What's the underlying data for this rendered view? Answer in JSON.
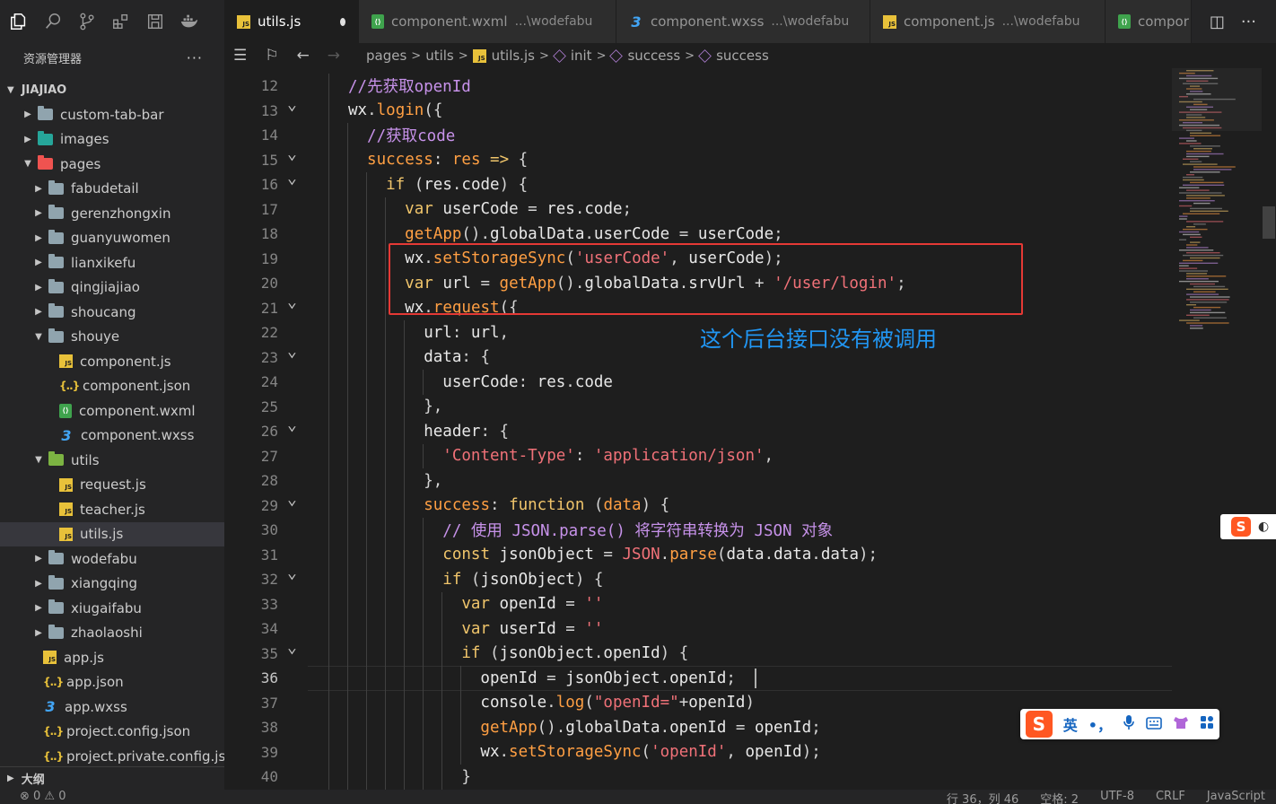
{
  "tabs": [
    {
      "name": "utils.js",
      "desc": "",
      "icon": "js",
      "active": true,
      "modified": true
    },
    {
      "name": "component.wxml",
      "desc": "...\\wodefabu",
      "icon": "wxml"
    },
    {
      "name": "component.wxss",
      "desc": "...\\wodefabu",
      "icon": "css"
    },
    {
      "name": "component.js",
      "desc": "...\\wodefabu",
      "icon": "js"
    },
    {
      "name": "compor",
      "desc": "",
      "icon": "wxml"
    }
  ],
  "sidebar": {
    "title": "资源管理器",
    "more": "···",
    "root": "JIAJIAO",
    "items": [
      {
        "label": "custom-tab-bar",
        "depth": 0,
        "type": "folder",
        "open": false
      },
      {
        "label": "images",
        "depth": 0,
        "type": "folder-images",
        "open": false
      },
      {
        "label": "pages",
        "depth": 0,
        "type": "folder-pages",
        "open": true
      },
      {
        "label": "fabudetail",
        "depth": 1,
        "type": "folder",
        "open": false
      },
      {
        "label": "gerenzhongxin",
        "depth": 1,
        "type": "folder",
        "open": false
      },
      {
        "label": "guanyuwomen",
        "depth": 1,
        "type": "folder",
        "open": false
      },
      {
        "label": "lianxikefu",
        "depth": 1,
        "type": "folder",
        "open": false
      },
      {
        "label": "qingjiajiao",
        "depth": 1,
        "type": "folder",
        "open": false
      },
      {
        "label": "shoucang",
        "depth": 1,
        "type": "folder",
        "open": false
      },
      {
        "label": "shouye",
        "depth": 1,
        "type": "folder",
        "open": true
      },
      {
        "label": "component.js",
        "depth": 2,
        "type": "js"
      },
      {
        "label": "component.json",
        "depth": 2,
        "type": "json"
      },
      {
        "label": "component.wxml",
        "depth": 2,
        "type": "wxml"
      },
      {
        "label": "component.wxss",
        "depth": 2,
        "type": "css"
      },
      {
        "label": "utils",
        "depth": 1,
        "type": "folder-utils",
        "open": true
      },
      {
        "label": "request.js",
        "depth": 2,
        "type": "js"
      },
      {
        "label": "teacher.js",
        "depth": 2,
        "type": "js"
      },
      {
        "label": "utils.js",
        "depth": 2,
        "type": "js",
        "selected": true
      },
      {
        "label": "wodefabu",
        "depth": 1,
        "type": "folder",
        "open": false
      },
      {
        "label": "xiangqing",
        "depth": 1,
        "type": "folder",
        "open": false
      },
      {
        "label": "xiugaifabu",
        "depth": 1,
        "type": "folder",
        "open": false
      },
      {
        "label": "zhaolaoshi",
        "depth": 1,
        "type": "folder",
        "open": false
      },
      {
        "label": "app.js",
        "depth": 0.5,
        "type": "js"
      },
      {
        "label": "app.json",
        "depth": 0.5,
        "type": "json"
      },
      {
        "label": "app.wxss",
        "depth": 0.5,
        "type": "css"
      },
      {
        "label": "project.config.json",
        "depth": 0.5,
        "type": "json"
      },
      {
        "label": "project.private.config.js...",
        "depth": 0.5,
        "type": "json"
      }
    ],
    "outline": "大纲"
  },
  "breadcrumb": {
    "items": [
      "pages",
      "utils",
      "utils.js",
      "init",
      "success",
      "success"
    ]
  },
  "editor": {
    "current_line": 36,
    "lines": [
      {
        "n": "12",
        "fold": false,
        "indent": 2,
        "tokens": [
          [
            "t-cm",
            "//先获取openId"
          ]
        ]
      },
      {
        "n": "13",
        "fold": true,
        "indent": 2,
        "tokens": [
          [
            "t-id",
            "wx"
          ],
          [
            "t-prop",
            "."
          ],
          [
            "t-fn",
            "login"
          ],
          [
            "t-prop",
            "({"
          ]
        ]
      },
      {
        "n": "14",
        "fold": false,
        "indent": 3,
        "tokens": [
          [
            "t-cm",
            "//获取code"
          ]
        ]
      },
      {
        "n": "15",
        "fold": true,
        "indent": 3,
        "tokens": [
          [
            "t-fn",
            "success"
          ],
          [
            "t-prop",
            ": "
          ],
          [
            "t-fn",
            "res"
          ],
          [
            "t-prop",
            " "
          ],
          [
            "t-key",
            "=>"
          ],
          [
            "t-prop",
            " {"
          ]
        ]
      },
      {
        "n": "16",
        "fold": true,
        "indent": 4,
        "tokens": [
          [
            "t-key",
            "if"
          ],
          [
            "t-prop",
            " ("
          ],
          [
            "t-id",
            "res"
          ],
          [
            "t-prop",
            "."
          ],
          [
            "t-id",
            "code"
          ],
          [
            "t-prop",
            ") {"
          ]
        ]
      },
      {
        "n": "17",
        "fold": false,
        "indent": 5,
        "tokens": [
          [
            "t-key",
            "var"
          ],
          [
            "t-prop",
            " "
          ],
          [
            "t-id",
            "userCode"
          ],
          [
            "t-prop",
            " = "
          ],
          [
            "t-id",
            "res"
          ],
          [
            "t-prop",
            "."
          ],
          [
            "t-id",
            "code"
          ],
          [
            "t-prop",
            ";"
          ]
        ]
      },
      {
        "n": "18",
        "fold": false,
        "indent": 5,
        "tokens": [
          [
            "t-fn",
            "getApp"
          ],
          [
            "t-prop",
            "()."
          ],
          [
            "t-id",
            "globalData"
          ],
          [
            "t-prop",
            "."
          ],
          [
            "t-id",
            "userCode"
          ],
          [
            "t-prop",
            " = "
          ],
          [
            "t-id",
            "userCode"
          ],
          [
            "t-prop",
            ";"
          ]
        ]
      },
      {
        "n": "19",
        "fold": false,
        "indent": 5,
        "tokens": [
          [
            "t-id",
            "wx"
          ],
          [
            "t-prop",
            "."
          ],
          [
            "t-fn",
            "setStorageSync"
          ],
          [
            "t-prop",
            "("
          ],
          [
            "t-str",
            "'userCode'"
          ],
          [
            "t-prop",
            ", "
          ],
          [
            "t-id",
            "userCode"
          ],
          [
            "t-prop",
            ");"
          ]
        ]
      },
      {
        "n": "20",
        "fold": false,
        "indent": 5,
        "tokens": [
          [
            "t-key",
            "var"
          ],
          [
            "t-prop",
            " "
          ],
          [
            "t-id",
            "url"
          ],
          [
            "t-prop",
            " = "
          ],
          [
            "t-fn",
            "getApp"
          ],
          [
            "t-prop",
            "()."
          ],
          [
            "t-id",
            "globalData"
          ],
          [
            "t-prop",
            "."
          ],
          [
            "t-id",
            "srvUrl"
          ],
          [
            "t-prop",
            " + "
          ],
          [
            "t-str",
            "'/user/login'"
          ],
          [
            "t-prop",
            ";"
          ]
        ]
      },
      {
        "n": "21",
        "fold": true,
        "indent": 5,
        "tokens": [
          [
            "t-id",
            "wx"
          ],
          [
            "t-prop",
            "."
          ],
          [
            "t-fn",
            "request"
          ],
          [
            "t-prop",
            "({"
          ]
        ]
      },
      {
        "n": "22",
        "fold": false,
        "indent": 6,
        "tokens": [
          [
            "t-id",
            "url"
          ],
          [
            "t-prop",
            ": "
          ],
          [
            "t-id",
            "url"
          ],
          [
            "t-prop",
            ","
          ]
        ]
      },
      {
        "n": "23",
        "fold": true,
        "indent": 6,
        "tokens": [
          [
            "t-id",
            "data"
          ],
          [
            "t-prop",
            ": {"
          ]
        ]
      },
      {
        "n": "24",
        "fold": false,
        "indent": 7,
        "tokens": [
          [
            "t-id",
            "userCode"
          ],
          [
            "t-prop",
            ": "
          ],
          [
            "t-id",
            "res"
          ],
          [
            "t-prop",
            "."
          ],
          [
            "t-id",
            "code"
          ]
        ]
      },
      {
        "n": "25",
        "fold": false,
        "indent": 6,
        "tokens": [
          [
            "t-prop",
            "},"
          ]
        ]
      },
      {
        "n": "26",
        "fold": true,
        "indent": 6,
        "tokens": [
          [
            "t-id",
            "header"
          ],
          [
            "t-prop",
            ": {"
          ]
        ]
      },
      {
        "n": "27",
        "fold": false,
        "indent": 7,
        "tokens": [
          [
            "t-str",
            "'Content-Type'"
          ],
          [
            "t-prop",
            ": "
          ],
          [
            "t-str",
            "'application/json'"
          ],
          [
            "t-prop",
            ","
          ]
        ]
      },
      {
        "n": "28",
        "fold": false,
        "indent": 6,
        "tokens": [
          [
            "t-prop",
            "},"
          ]
        ]
      },
      {
        "n": "29",
        "fold": true,
        "indent": 6,
        "tokens": [
          [
            "t-fn",
            "success"
          ],
          [
            "t-prop",
            ": "
          ],
          [
            "t-key",
            "function"
          ],
          [
            "t-prop",
            " ("
          ],
          [
            "t-fn",
            "data"
          ],
          [
            "t-prop",
            ") {"
          ]
        ]
      },
      {
        "n": "30",
        "fold": false,
        "indent": 7,
        "tokens": [
          [
            "t-cm",
            "// 使用 JSON.parse() 将字符串转换为 JSON 对象"
          ]
        ]
      },
      {
        "n": "31",
        "fold": false,
        "indent": 7,
        "tokens": [
          [
            "t-key",
            "const"
          ],
          [
            "t-prop",
            " "
          ],
          [
            "t-id",
            "jsonObject"
          ],
          [
            "t-prop",
            " = "
          ],
          [
            "t-str",
            "JSON"
          ],
          [
            "t-prop",
            "."
          ],
          [
            "t-fn",
            "parse"
          ],
          [
            "t-prop",
            "("
          ],
          [
            "t-id",
            "data"
          ],
          [
            "t-prop",
            "."
          ],
          [
            "t-id",
            "data"
          ],
          [
            "t-prop",
            "."
          ],
          [
            "t-id",
            "data"
          ],
          [
            "t-prop",
            ");"
          ]
        ]
      },
      {
        "n": "32",
        "fold": true,
        "indent": 7,
        "tokens": [
          [
            "t-key",
            "if"
          ],
          [
            "t-prop",
            " ("
          ],
          [
            "t-id",
            "jsonObject"
          ],
          [
            "t-prop",
            ") {"
          ]
        ]
      },
      {
        "n": "33",
        "fold": false,
        "indent": 8,
        "tokens": [
          [
            "t-key",
            "var"
          ],
          [
            "t-prop",
            " "
          ],
          [
            "t-id",
            "openId"
          ],
          [
            "t-prop",
            " = "
          ],
          [
            "t-str",
            "''"
          ]
        ]
      },
      {
        "n": "34",
        "fold": false,
        "indent": 8,
        "tokens": [
          [
            "t-key",
            "var"
          ],
          [
            "t-prop",
            " "
          ],
          [
            "t-id",
            "userId"
          ],
          [
            "t-prop",
            " = "
          ],
          [
            "t-str",
            "''"
          ]
        ]
      },
      {
        "n": "35",
        "fold": true,
        "indent": 8,
        "tokens": [
          [
            "t-key",
            "if"
          ],
          [
            "t-prop",
            " ("
          ],
          [
            "t-id",
            "jsonObject"
          ],
          [
            "t-prop",
            "."
          ],
          [
            "t-id",
            "openId"
          ],
          [
            "t-prop",
            ") {"
          ]
        ]
      },
      {
        "n": "36",
        "fold": false,
        "indent": 9,
        "tokens": [
          [
            "t-id",
            "openId"
          ],
          [
            "t-prop",
            " = "
          ],
          [
            "t-id",
            "jsonObject"
          ],
          [
            "t-prop",
            "."
          ],
          [
            "t-id",
            "openId"
          ],
          [
            "t-prop",
            ";"
          ]
        ]
      },
      {
        "n": "37",
        "fold": false,
        "indent": 9,
        "tokens": [
          [
            "t-id",
            "console"
          ],
          [
            "t-prop",
            "."
          ],
          [
            "t-fn",
            "log"
          ],
          [
            "t-prop",
            "("
          ],
          [
            "t-str",
            "\"openId=\""
          ],
          [
            "t-prop",
            "+"
          ],
          [
            "t-id",
            "openId"
          ],
          [
            "t-prop",
            ")"
          ]
        ]
      },
      {
        "n": "38",
        "fold": false,
        "indent": 9,
        "tokens": [
          [
            "t-fn",
            "getApp"
          ],
          [
            "t-prop",
            "()."
          ],
          [
            "t-id",
            "globalData"
          ],
          [
            "t-prop",
            "."
          ],
          [
            "t-id",
            "openId"
          ],
          [
            "t-prop",
            " = "
          ],
          [
            "t-id",
            "openId"
          ],
          [
            "t-prop",
            ";"
          ]
        ]
      },
      {
        "n": "39",
        "fold": false,
        "indent": 9,
        "tokens": [
          [
            "t-id",
            "wx"
          ],
          [
            "t-prop",
            "."
          ],
          [
            "t-fn",
            "setStorageSync"
          ],
          [
            "t-prop",
            "("
          ],
          [
            "t-str",
            "'openId'"
          ],
          [
            "t-prop",
            ", "
          ],
          [
            "t-id",
            "openId"
          ],
          [
            "t-prop",
            ");"
          ]
        ]
      },
      {
        "n": "40",
        "fold": false,
        "indent": 8,
        "tokens": [
          [
            "t-prop",
            "}"
          ]
        ]
      }
    ]
  },
  "annotation": {
    "note": "这个后台接口没有被调用",
    "box_color": "#e53935",
    "note_color": "#2196f3"
  },
  "statusbar": {
    "left": "⊗ 0  ⚠ 0",
    "position": "行 36，列 46",
    "spaces": "空格: 2",
    "encoding": "UTF-8",
    "eol": "CRLF",
    "language": "JavaScript"
  },
  "ime": {
    "logo": "S",
    "lang": "英",
    "punct": "•，"
  }
}
